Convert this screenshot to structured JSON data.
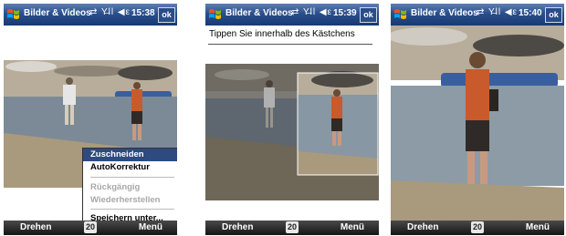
{
  "app": {
    "title": "Bilder & Videos",
    "status_icons": "⇄ Y̶ll ◀ε",
    "ok_label": "ok"
  },
  "screens": [
    {
      "time": "15:38",
      "left_softkey": "Drehen",
      "center_softkey": "20",
      "right_softkey": "Menü"
    },
    {
      "time": "15:39",
      "left_softkey": "Drehen",
      "center_softkey": "20",
      "right_softkey": "Menü",
      "instruction": "Tippen Sie innerhalb des Kästchens"
    },
    {
      "time": "15:40",
      "left_softkey": "Drehen",
      "center_softkey": "20",
      "right_softkey": "Menü"
    }
  ],
  "context_menu": {
    "items": [
      {
        "label": "Zuschneiden",
        "state": "highlighted"
      },
      {
        "label": "AutoKorrektur",
        "state": "enabled"
      },
      {
        "label": "Rückgängig",
        "state": "disabled"
      },
      {
        "label": "Wiederherstellen",
        "state": "disabled"
      },
      {
        "label": "Speichern unter...",
        "state": "enabled"
      }
    ]
  },
  "colors": {
    "titlebar": "#2b4f8c",
    "menu_highlight": "#2e4a80",
    "softkey_bar": "#151515"
  }
}
